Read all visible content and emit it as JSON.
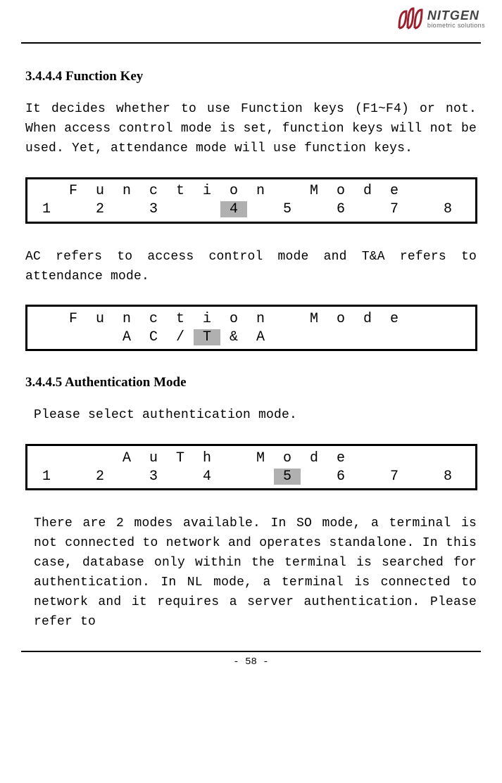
{
  "logo": {
    "brand": "NITGEN",
    "sub": "biometric solutions"
  },
  "section1": {
    "heading": "3.4.4.4  Function Key",
    "para1": "It decides whether to use Function keys (F1~F4) or not. When access control mode is set, function keys will not be used. Yet, attendance mode will use function keys.",
    "para2": "AC refers to access control mode and T&A refers to attendance mode."
  },
  "lcd1": {
    "line1": [
      "",
      "F",
      "u",
      "n",
      "c",
      "t",
      "i",
      "o",
      "n",
      "",
      "M",
      "o",
      "d",
      "e",
      "",
      ""
    ],
    "line2": [
      "1",
      "",
      "2",
      "",
      "3",
      "",
      "",
      "4",
      "",
      "5",
      "",
      "6",
      "",
      "7",
      "",
      "8"
    ],
    "highlight_row": 2,
    "highlight_col": 7
  },
  "lcd2": {
    "line1": [
      "",
      "F",
      "u",
      "n",
      "c",
      "t",
      "i",
      "o",
      "n",
      "",
      "M",
      "o",
      "d",
      "e",
      "",
      ""
    ],
    "line2": [
      "",
      "",
      "",
      "A",
      "C",
      "/",
      "T",
      "&",
      "A",
      "",
      "",
      "",
      "",
      "",
      "",
      ""
    ],
    "highlight_row": 2,
    "highlight_col": 6
  },
  "section2": {
    "heading": "3.4.4.5 Authentication Mode",
    "para1": "Please select authentication mode.",
    "para2": "There are 2 modes available. In SO mode, a terminal is not connected to network and operates standalone. In this case, database only within the terminal is searched for authentication. In NL mode, a terminal is connected to network and it requires a server authentication. Please refer to"
  },
  "lcd3": {
    "line1": [
      "",
      "",
      "",
      "A",
      "u",
      "T",
      "h",
      "",
      "M",
      "o",
      "d",
      "e",
      "",
      "",
      "",
      ""
    ],
    "line2": [
      "1",
      "",
      "2",
      "",
      "3",
      "",
      "4",
      "",
      "",
      "5",
      "",
      "6",
      "",
      "7",
      "",
      "8"
    ],
    "highlight_row": 2,
    "highlight_col": 9
  },
  "page_number": "- 58 -"
}
